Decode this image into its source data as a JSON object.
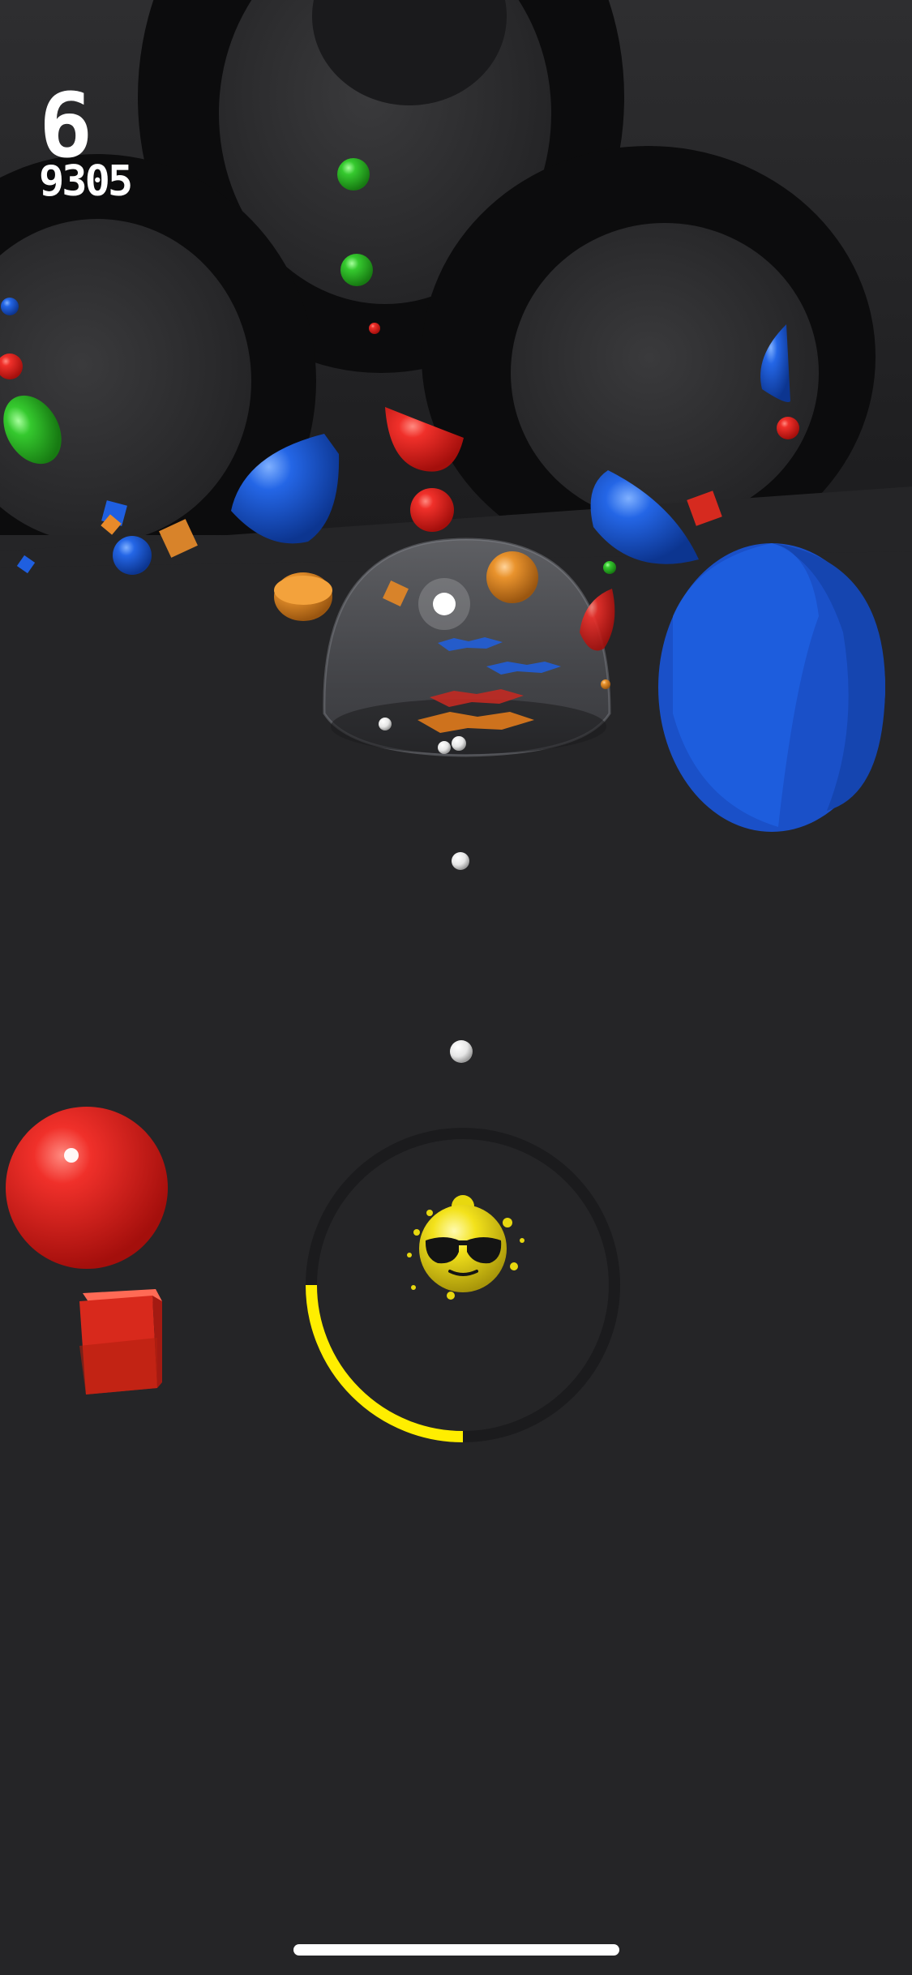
{
  "hud": {
    "level": "6",
    "score": "9305"
  },
  "progress_ring": {
    "fill_fraction": 0.25,
    "color": "#ffee00"
  },
  "player": {
    "icon": "sunglasses-face-icon",
    "color": "#f5e41a"
  },
  "colors": {
    "background": "#252527",
    "red": "#e3261c",
    "blue": "#1a5fe0",
    "green": "#2fc52a",
    "orange": "#f08a1c",
    "white": "#f4f4f4"
  }
}
